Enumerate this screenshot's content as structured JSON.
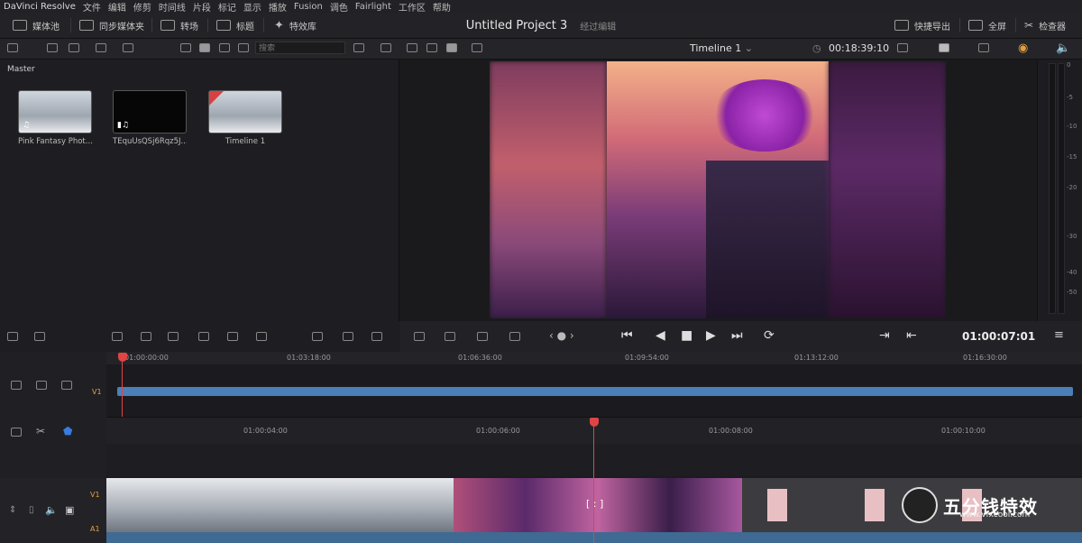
{
  "menu": {
    "app": "DaVinci Resolve",
    "items": [
      "文件",
      "编辑",
      "修剪",
      "时间线",
      "片段",
      "标记",
      "显示",
      "播放",
      "Fusion",
      "调色",
      "Fairlight",
      "工作区",
      "帮助"
    ]
  },
  "toolbar": {
    "media_pool": "媒体池",
    "sync_bin": "同步媒体夹",
    "transitions": "转场",
    "titles": "标题",
    "effects": "特效库",
    "project_name": "Untitled Project 3",
    "project_status": "经过编辑",
    "quick_export": "快捷导出",
    "fullscreen": "全屏",
    "inspector": "检查器"
  },
  "media_pool": {
    "search_placeholder": "搜索",
    "bin": "Master",
    "clips": [
      {
        "label": "Pink Fantasy Phot..."
      },
      {
        "label": "TEquUsQSj6Rqz5J..."
      },
      {
        "label": "Timeline 1"
      }
    ]
  },
  "viewer": {
    "timeline_name": "Timeline 1",
    "duration": "00:18:39:10",
    "current_tc": "01:00:07:01"
  },
  "meter": {
    "ticks": [
      "0",
      "-5",
      "-10",
      "-15",
      "-20",
      "-30",
      "-40",
      "-50"
    ]
  },
  "timeline": {
    "ruler_top": [
      "01:00:00:00",
      "01:03:18:00",
      "01:06:36:00",
      "01:09:54:00",
      "01:13:12:00",
      "01:16:30:00"
    ],
    "ruler_detail": [
      "01:00:04:00",
      "01:00:06:00",
      "01:00:08:00",
      "01:00:10:00"
    ],
    "track_v1": "V1",
    "track_a1": "A1",
    "cursor_marker": "[ : ]"
  },
  "watermark": {
    "text": "五分钱特效",
    "url": "www.vfxcool.com"
  },
  "colors": {
    "playhead": "#e04545",
    "clip_blue": "#4b7fb8",
    "audio_blue": "#3f6a93"
  }
}
